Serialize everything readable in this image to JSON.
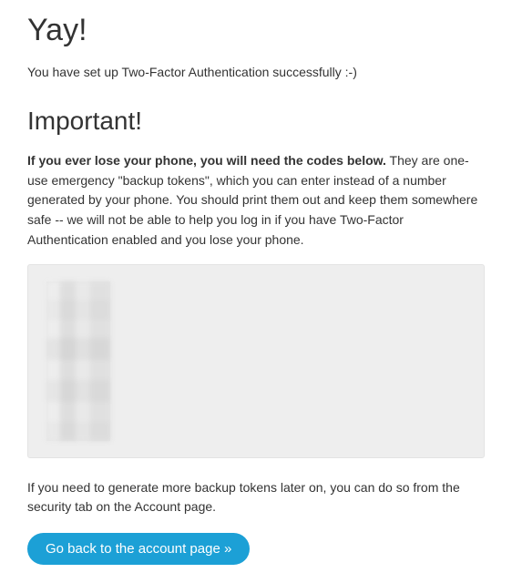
{
  "heading_primary": "Yay!",
  "success_message": "You have set up Two-Factor Authentication successfully :-)",
  "heading_secondary": "Important!",
  "warning_bold": "If you ever lose your phone, you will need the codes below.",
  "warning_rest": " They are one-use emergency \"backup tokens\", which you can enter instead of a number generated by your phone. You should print them out and keep them somewhere safe -- we will not be able to help you log in if you have Two-Factor Authentication enabled and you lose your phone.",
  "backup_tokens_visible": false,
  "more_tokens_info": "If you need to generate more backup tokens later on, you can do so from the security tab on the Account page.",
  "button_label": "Go back to the account page »"
}
